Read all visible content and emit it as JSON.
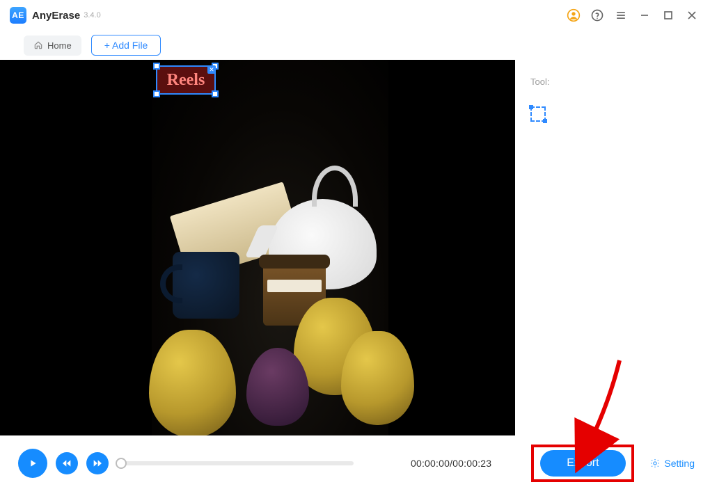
{
  "app": {
    "name": "AnyErase",
    "version": "3.4.0"
  },
  "toolbar": {
    "home": "Home",
    "add_file": "+ Add File"
  },
  "selection": {
    "label": "Reels"
  },
  "side": {
    "tool_label": "Tool:"
  },
  "playback": {
    "time": "00:00:00/00:00:23"
  },
  "footer": {
    "export": "Export",
    "setting": "Setting"
  }
}
